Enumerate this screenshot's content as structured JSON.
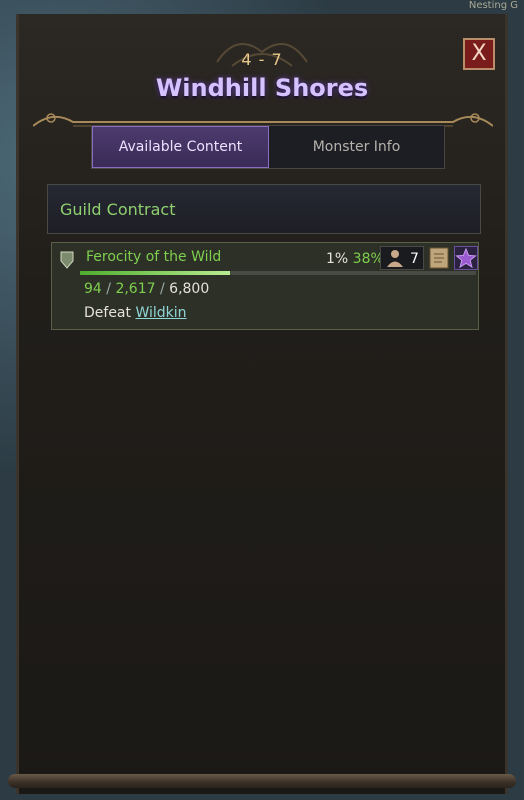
{
  "map": {
    "corner_label": "Nesting G"
  },
  "header": {
    "level_range": "4 - 7",
    "zone_name": "Windhill Shores",
    "close_label": "X"
  },
  "tabs": [
    {
      "label": "Available Content",
      "active": true
    },
    {
      "label": "Monster Info",
      "active": false
    }
  ],
  "section": {
    "title": "Guild Contract"
  },
  "contract": {
    "name": "Ferocity of the Wild",
    "percent_a": "1%",
    "percent_b": "38%",
    "party_count": "7",
    "progress": 0.38,
    "count_current": "94",
    "count_mid": "2,617",
    "count_total": "6,800",
    "task_prefix": "Defeat",
    "task_target": "Wildkin"
  },
  "colors": {
    "accent_green": "#7fcf4f",
    "zone_name": "#d6c2ff",
    "level": "#e8c98a"
  }
}
